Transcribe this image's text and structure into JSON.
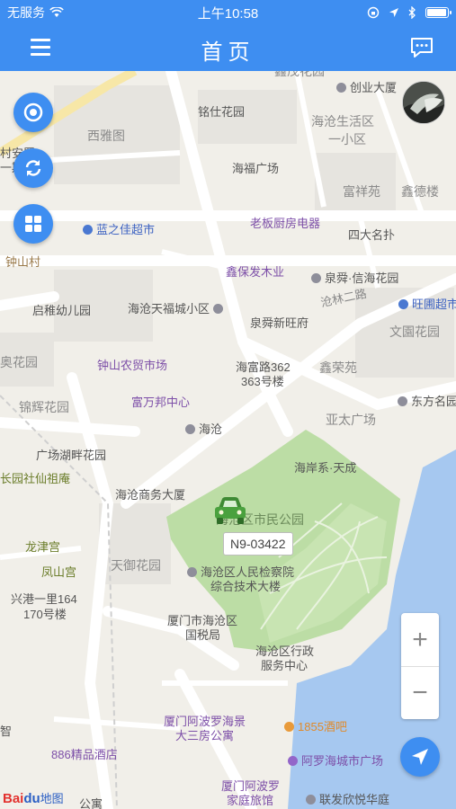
{
  "status_bar": {
    "carrier": "无服务",
    "time": "上午10:58",
    "battery_level": 0.95
  },
  "header": {
    "title": "首页"
  },
  "map": {
    "labels": [
      {
        "id": "lbl-0",
        "text": "鑫茂花园",
        "cls": "gray"
      },
      {
        "id": "lbl-1",
        "text": "创业大厦",
        "cls": ""
      },
      {
        "id": "lbl-2",
        "text": "铭仕花园",
        "cls": ""
      },
      {
        "id": "lbl-3",
        "text": "西雅图",
        "cls": "gray"
      },
      {
        "id": "lbl-4",
        "text": "海沧生活区",
        "cls": "gray"
      },
      {
        "id": "lbl-5",
        "text": "一小区",
        "cls": "gray"
      },
      {
        "id": "lbl-6",
        "text": "村安置",
        "cls": ""
      },
      {
        "id": "lbl-7",
        "text": "一期",
        "cls": ""
      },
      {
        "id": "lbl-8",
        "text": "海福广场",
        "cls": ""
      },
      {
        "id": "lbl-9",
        "text": "富祥苑",
        "cls": "gray"
      },
      {
        "id": "lbl-10",
        "text": "鑫德楼",
        "cls": "gray"
      },
      {
        "id": "lbl-11",
        "text": "蓝之佳超市",
        "cls": "blue"
      },
      {
        "id": "lbl-12",
        "text": "老板厨房电器",
        "cls": "purple"
      },
      {
        "id": "lbl-13",
        "text": "四大名扑",
        "cls": ""
      },
      {
        "id": "lbl-14",
        "text": "钟山村",
        "cls": "brown"
      },
      {
        "id": "lbl-15",
        "text": "鑫保发木业",
        "cls": "purple"
      },
      {
        "id": "lbl-16",
        "text": "泉舜·信海花园",
        "cls": ""
      },
      {
        "id": "lbl-17",
        "text": "启稚幼儿园",
        "cls": ""
      },
      {
        "id": "lbl-18",
        "text": "海沧天福城小区",
        "cls": ""
      },
      {
        "id": "lbl-19",
        "text": "沧林二路",
        "cls": "gray"
      },
      {
        "id": "lbl-20",
        "text": "旺圃超市",
        "cls": "blue"
      },
      {
        "id": "lbl-21",
        "text": "泉舜新旺府",
        "cls": ""
      },
      {
        "id": "lbl-22",
        "text": "文園花园",
        "cls": "gray"
      },
      {
        "id": "lbl-23",
        "text": "奥花园",
        "cls": "gray"
      },
      {
        "id": "lbl-24",
        "text": "钟山农贸市场",
        "cls": "purple"
      },
      {
        "id": "lbl-25",
        "text": "海富路362",
        "cls": ""
      },
      {
        "id": "lbl-26",
        "text": "363号楼",
        "cls": ""
      },
      {
        "id": "lbl-27",
        "text": "鑫荣苑",
        "cls": "gray"
      },
      {
        "id": "lbl-28",
        "text": "锦辉花园",
        "cls": "gray"
      },
      {
        "id": "lbl-29",
        "text": "富万邦中心",
        "cls": "purple"
      },
      {
        "id": "lbl-30",
        "text": "东方名园",
        "cls": ""
      },
      {
        "id": "lbl-31",
        "text": "亚太广场",
        "cls": "gray"
      },
      {
        "id": "lbl-32",
        "text": "海沧",
        "cls": ""
      },
      {
        "id": "lbl-33",
        "text": "广场湖畔花园",
        "cls": ""
      },
      {
        "id": "lbl-34",
        "text": "海岸系·天成",
        "cls": ""
      },
      {
        "id": "lbl-35",
        "text": "长园社仙祖庵",
        "cls": "green"
      },
      {
        "id": "lbl-36",
        "text": "海沧商务大厦",
        "cls": ""
      },
      {
        "id": "lbl-37",
        "text": "海沧区市民公园",
        "cls": "park"
      },
      {
        "id": "lbl-38",
        "text": "龙津宫",
        "cls": "green"
      },
      {
        "id": "lbl-39",
        "text": "天御花园",
        "cls": "gray"
      },
      {
        "id": "lbl-40",
        "text": "凤山宫",
        "cls": "green"
      },
      {
        "id": "lbl-41",
        "text": "海沧区人民检察院",
        "cls": ""
      },
      {
        "id": "lbl-42",
        "text": "综合技术大楼",
        "cls": ""
      },
      {
        "id": "lbl-43",
        "text": "兴港一里164",
        "cls": ""
      },
      {
        "id": "lbl-44",
        "text": "170号楼",
        "cls": ""
      },
      {
        "id": "lbl-45",
        "text": "厦门市海沧区",
        "cls": ""
      },
      {
        "id": "lbl-46",
        "text": "国税局",
        "cls": ""
      },
      {
        "id": "lbl-47",
        "text": "海沧区行政",
        "cls": ""
      },
      {
        "id": "lbl-48",
        "text": "服务中心",
        "cls": ""
      },
      {
        "id": "lbl-49",
        "text": "厦门阿波罗海景",
        "cls": "purple"
      },
      {
        "id": "lbl-50",
        "text": "大三房公寓",
        "cls": "purple"
      },
      {
        "id": "lbl-51",
        "text": "1855酒吧",
        "cls": "orange"
      },
      {
        "id": "lbl-52",
        "text": "886精品酒店",
        "cls": "purple"
      },
      {
        "id": "lbl-53",
        "text": "阿罗海城市广场",
        "cls": "purple"
      },
      {
        "id": "lbl-54",
        "text": "厦门阿波罗",
        "cls": "purple"
      },
      {
        "id": "lbl-55",
        "text": "家庭旅馆",
        "cls": "purple"
      },
      {
        "id": "lbl-56",
        "text": "联发欣悦华庭",
        "cls": ""
      },
      {
        "id": "lbl-57",
        "text": "公寓",
        "cls": ""
      },
      {
        "id": "lbl-58",
        "text": "智",
        "cls": ""
      }
    ]
  },
  "vehicle": {
    "plate": "N9-03422"
  },
  "controls": {
    "zoom_in": "+",
    "zoom_out": "−"
  },
  "baidu": {
    "brand_left": "Bai",
    "paw": "du",
    "brand_right": "地图"
  },
  "colors": {
    "primary": "#3e8ef1",
    "park": "#b8dba0",
    "water": "#a6c8f0"
  }
}
